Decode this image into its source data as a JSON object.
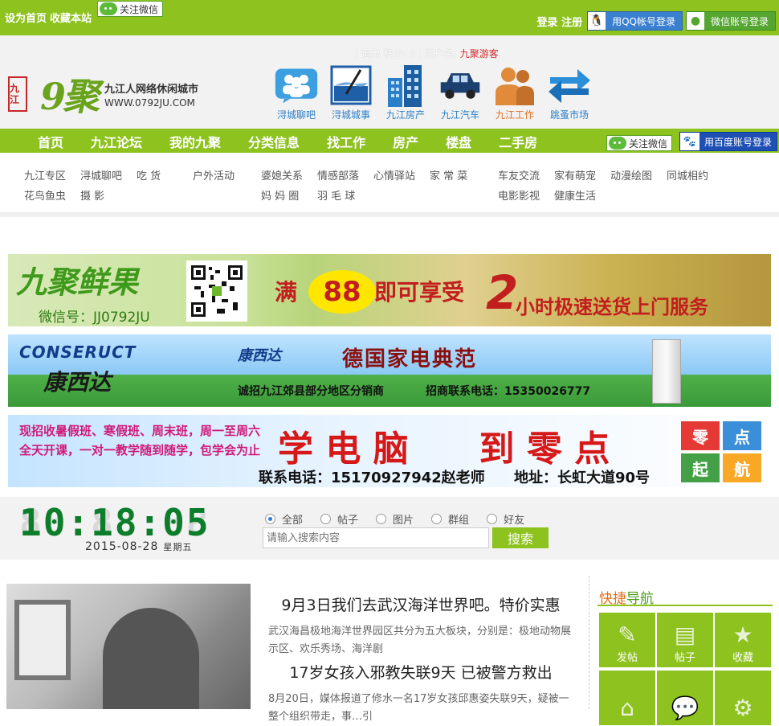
{
  "topbar": {
    "set_home": "设为首页",
    "bookmark": "收藏本站",
    "wechat_follow": "关注微信",
    "login": "登录",
    "register": "注册",
    "qq_login": "用QQ帐号登录",
    "wechat_login": "微信账号登录"
  },
  "header": {
    "logo_seal": "九江",
    "logo_mark": "9聚",
    "slogan": "九江人网络休闲城市",
    "site_url": "WWW.0792JU.COM",
    "userinfo_prefix": "| 退出 积分: 0 | 用户名:",
    "username": "九聚游客",
    "quick_links": [
      {
        "label": "浔城聊吧",
        "icon": "chat-people-icon"
      },
      {
        "label": "浔城城事",
        "icon": "drawing-icon"
      },
      {
        "label": "九江房产",
        "icon": "building-icon"
      },
      {
        "label": "九江汽车",
        "icon": "car-icon"
      },
      {
        "label": "九江工作",
        "icon": "worker-icon"
      },
      {
        "label": "跳蚤市场",
        "icon": "exchange-arrows-icon"
      }
    ]
  },
  "nav": {
    "items": [
      "首页",
      "九江论坛",
      "我的九聚",
      "分类信息",
      "找工作",
      "房产",
      "楼盘",
      "二手房"
    ],
    "wechat_follow": "关注微信",
    "baidu_login": "用百度账号登录"
  },
  "categories": {
    "row1": [
      "九江专区",
      "浔城聊吧",
      "吃 货",
      "户外活动",
      "婆媳关系",
      "情感部落",
      "心情驿站",
      "家 常 菜",
      "车友交流",
      "家有萌宠",
      "动漫绘图",
      "同城相约"
    ],
    "row2": [
      "花鸟鱼虫",
      "摄 影",
      "妈 妈 圈",
      "羽 毛 球",
      "电影影视",
      "健康生活"
    ]
  },
  "banners": {
    "b1": {
      "brand": "九聚鲜果",
      "wechat": "微信号：JJ0792JU",
      "offer_prefix": "满",
      "offer_num": "88",
      "offer_suffix": "即可享受",
      "service_num": "2",
      "service": "小时极速送货上门服务"
    },
    "b2": {
      "brand_en": "CONSERUCT",
      "brand_cn": "康西达",
      "brand_small": "康西达",
      "headline": "德国家电典范",
      "recruit": "诚招九江郊县部分地区分销商",
      "phone": "招商联系电话：15350026777"
    },
    "b3": {
      "left_text": "现招收暑假班、寒假班、周末班，周一至周六全天开课，一对一教学随到随学，包学会为止",
      "headline": "学 电 脑　　到 零 点",
      "contact": "联系电话：15170927942赵老师",
      "address": "地址：长虹大道90号",
      "tiles": [
        "零",
        "点",
        "起",
        "航"
      ]
    }
  },
  "search": {
    "clock_time": "10:18:05",
    "clock_bg": "88:88:88",
    "date": "2015-08-28",
    "weekday": "星期五",
    "options": [
      "全部",
      "帖子",
      "图片",
      "群组",
      "好友"
    ],
    "selected": "全部",
    "placeholder": "请输入搜索内容",
    "button": "搜索"
  },
  "news": [
    {
      "title": "9月3日我们去武汉海洋世界吧。特价实惠",
      "desc": "武汉海昌极地海洋世界园区共分为五大板块，分别是：极地动物展示区、欢乐秀场、海洋剧"
    },
    {
      "title": "17岁女孩入邪教失联9天 已被警方救出",
      "desc": "8月20日，媒体报道了修水一名17岁女孩邱惠姿失联9天，疑被一整个组织带走，事…引"
    }
  ],
  "side": {
    "title_a": "快捷",
    "title_b": "导航",
    "tiles": [
      {
        "label": "发帖",
        "icon": "pencil-icon"
      },
      {
        "label": "帖子",
        "icon": "document-icon"
      },
      {
        "label": "收藏",
        "icon": "star-icon"
      },
      {
        "label": "",
        "icon": "home-icon"
      },
      {
        "label": "",
        "icon": "speech-bubble-icon"
      },
      {
        "label": "",
        "icon": "gear-icon"
      }
    ]
  }
}
